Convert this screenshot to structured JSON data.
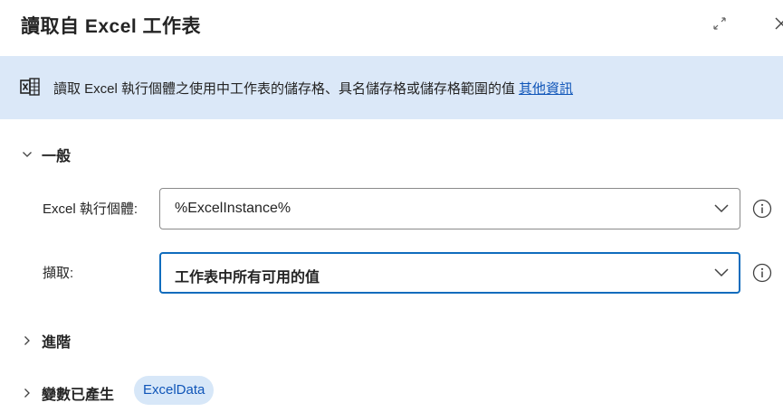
{
  "dialog": {
    "title": "讀取自 Excel 工作表",
    "expand_icon": "expand-icon",
    "close_icon": "close-icon"
  },
  "info_bar": {
    "icon": "excel-read-icon",
    "text": "讀取 Excel 執行個體之使用中工作表的儲存格、具名儲存格或儲存格範圍的值",
    "link": "其他資訊",
    "link_color": "#0f55b8",
    "background": "#dbe8f8"
  },
  "general": {
    "header": "一般",
    "excel_instance": {
      "label": "Excel 執行個體:",
      "value": "%ExcelInstance%"
    },
    "retrieve": {
      "label": "擷取:",
      "value": "工作表中所有可用的值"
    }
  },
  "advanced": {
    "header": "進階"
  },
  "variables": {
    "header": "變數已產生",
    "items": [
      "ExcelData"
    ]
  },
  "colors": {
    "accent": "#0f6cbd",
    "badge_bg": "#d7e7f8"
  }
}
